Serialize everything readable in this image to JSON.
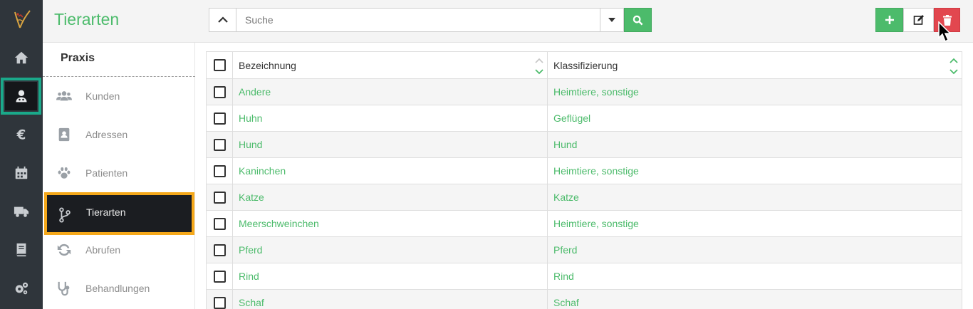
{
  "rail": {
    "items": [
      {
        "name": "home-icon"
      },
      {
        "name": "medical-staff-icon",
        "active": true
      },
      {
        "name": "euro-icon"
      },
      {
        "name": "calendar-icon"
      },
      {
        "name": "truck-icon"
      },
      {
        "name": "book-icon"
      },
      {
        "name": "settings-icon"
      }
    ],
    "active_color": "#1aa98a"
  },
  "header": {
    "title": "Tierarten",
    "search_placeholder": "Suche",
    "accent": "#4cbb6b",
    "danger": "#e2474f"
  },
  "subnav": {
    "title": "Praxis",
    "items": [
      {
        "label": "Kunden",
        "icon": "users-icon"
      },
      {
        "label": "Adressen",
        "icon": "address-book-icon"
      },
      {
        "label": "Patienten",
        "icon": "paw-icon"
      },
      {
        "label": "Tierarten",
        "icon": "code-branch-icon",
        "active": true
      },
      {
        "label": "Abrufen",
        "icon": "sync-icon"
      },
      {
        "label": "Behandlungen",
        "icon": "stethoscope-icon"
      }
    ],
    "active_color": "#f5a81a"
  },
  "table": {
    "columns": [
      "Bezeichnung",
      "Klassifizierung"
    ],
    "rows": [
      [
        "Andere",
        "Heimtiere, sonstige"
      ],
      [
        "Huhn",
        "Geflügel"
      ],
      [
        "Hund",
        "Hund"
      ],
      [
        "Kaninchen",
        "Heimtiere, sonstige"
      ],
      [
        "Katze",
        "Katze"
      ],
      [
        "Meerschweinchen",
        "Heimtiere, sonstige"
      ],
      [
        "Pferd",
        "Pferd"
      ],
      [
        "Rind",
        "Rind"
      ],
      [
        "Schaf",
        "Schaf"
      ]
    ]
  }
}
